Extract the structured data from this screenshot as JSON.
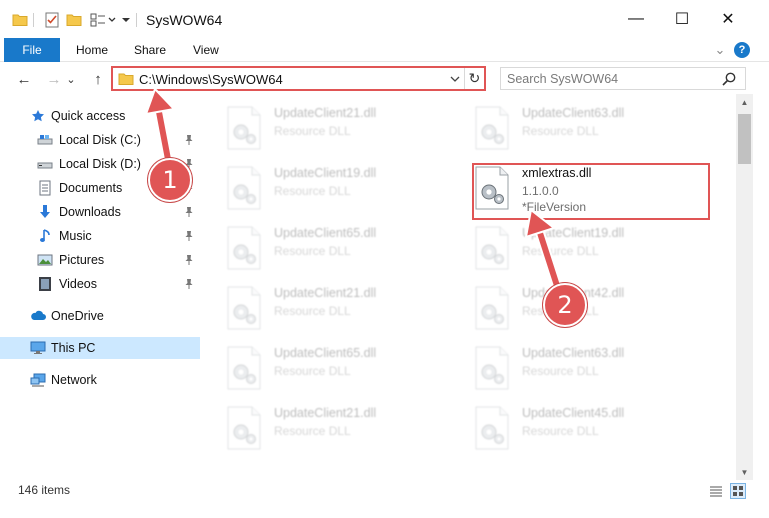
{
  "window": {
    "title": "SysWOW64",
    "minimize_glyph": "—",
    "maximize_glyph": "☐",
    "close_glyph": "✕"
  },
  "ribbon": {
    "tabs": [
      "File",
      "Home",
      "Share",
      "View"
    ],
    "collapse_glyph": "⌄",
    "help_glyph": "?"
  },
  "address": {
    "path": "C:\\Windows\\SysWOW64",
    "back_glyph": "←",
    "forward_glyph": "→",
    "recent_glyph": "⌄",
    "up_glyph": "↑",
    "refresh_glyph": "↻"
  },
  "search": {
    "placeholder": "Search SysWOW64"
  },
  "nav": {
    "items": [
      {
        "label": "Quick access",
        "icon": "star-icon"
      },
      {
        "label": "Local Disk (C:)",
        "icon": "drive-icon",
        "pinned": true
      },
      {
        "label": "Local Disk (D:)",
        "icon": "drive-icon",
        "pinned": true
      },
      {
        "label": "Documents",
        "icon": "documents-icon",
        "pinned": true
      },
      {
        "label": "Downloads",
        "icon": "download-icon",
        "pinned": true
      },
      {
        "label": "Music",
        "icon": "music-icon",
        "pinned": true
      },
      {
        "label": "Pictures",
        "icon": "pictures-icon",
        "pinned": true
      },
      {
        "label": "Videos",
        "icon": "videos-icon",
        "pinned": true
      },
      {
        "label": "OneDrive",
        "icon": "cloud-icon"
      },
      {
        "label": "This PC",
        "icon": "computer-icon",
        "selected": true
      },
      {
        "label": "Network",
        "icon": "network-icon"
      }
    ]
  },
  "files": {
    "left": [
      {
        "name": "UpdateClient21.dll",
        "type": "Resource DLL"
      },
      {
        "name": "UpdateClient19.dll",
        "type": "Resource DLL"
      },
      {
        "name": "UpdateClient65.dll",
        "type": "Resource DLL"
      },
      {
        "name": "UpdateClient21.dll",
        "type": "Resource DLL"
      },
      {
        "name": "UpdateClient65.dll",
        "type": "Resource DLL"
      },
      {
        "name": "UpdateClient21.dll",
        "type": "Resource DLL"
      }
    ],
    "right": [
      {
        "name": "UpdateClient63.dll",
        "type": "Resource DLL"
      },
      {
        "name": "UpdateClient19.dll",
        "type": "Resource DLL"
      },
      {
        "name": "UpdateClient42.dll",
        "type": "Resource DLL"
      },
      {
        "name": "UpdateClient63.dll",
        "type": "Resource DLL"
      },
      {
        "name": "UpdateClient45.dll",
        "type": "Resource DLL"
      }
    ],
    "highlighted": {
      "name": "xmlextras.dll",
      "version": "1.1.0.0",
      "description": "*FileVersion"
    }
  },
  "status": {
    "item_count": "146 items"
  },
  "annotations": {
    "step1": "1",
    "step2": "2"
  },
  "colors": {
    "accent": "#1979ca",
    "annotation_red": "#e05555",
    "selection": "#cce8ff"
  }
}
